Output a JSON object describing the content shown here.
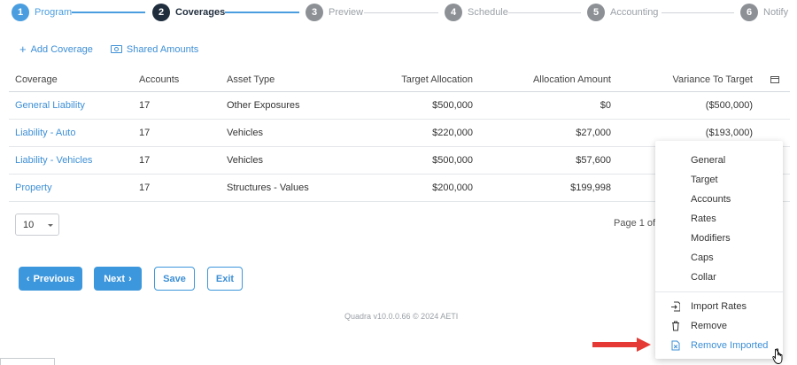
{
  "stepper": {
    "steps": [
      {
        "num": "1",
        "label": "Program"
      },
      {
        "num": "2",
        "label": "Coverages"
      },
      {
        "num": "3",
        "label": "Preview"
      },
      {
        "num": "4",
        "label": "Schedule"
      },
      {
        "num": "5",
        "label": "Accounting"
      },
      {
        "num": "6",
        "label": "Notify"
      }
    ]
  },
  "toolbar": {
    "add_coverage": "Add Coverage",
    "shared_amounts": "Shared Amounts"
  },
  "table": {
    "headers": {
      "coverage": "Coverage",
      "accounts": "Accounts",
      "asset_type": "Asset Type",
      "target_allocation": "Target Allocation",
      "allocation_amount": "Allocation Amount",
      "variance_to_target": "Variance To Target"
    },
    "rows": [
      {
        "coverage": "General Liability",
        "accounts": "17",
        "asset_type": "Other Exposures",
        "target_allocation": "$500,000",
        "allocation_amount": "$0",
        "variance_to_target": "($500,000)"
      },
      {
        "coverage": "Liability - Auto",
        "accounts": "17",
        "asset_type": "Vehicles",
        "target_allocation": "$220,000",
        "allocation_amount": "$27,000",
        "variance_to_target": "($193,000)"
      },
      {
        "coverage": "Liability - Vehicles",
        "accounts": "17",
        "asset_type": "Vehicles",
        "target_allocation": "$500,000",
        "allocation_amount": "$57,600",
        "variance_to_target": ""
      },
      {
        "coverage": "Property",
        "accounts": "17",
        "asset_type": "Structures - Values",
        "target_allocation": "$200,000",
        "allocation_amount": "$199,998",
        "variance_to_target": ""
      }
    ]
  },
  "pagination": {
    "page_size": "10",
    "page_info": "Page 1 of 1"
  },
  "buttons": {
    "previous": "Previous",
    "next": "Next",
    "save": "Save",
    "exit": "Exit"
  },
  "footer": "Quadra v10.0.0.66 © 2024 AETI",
  "context_menu": {
    "items": [
      "General",
      "Target",
      "Accounts",
      "Rates",
      "Modifiers",
      "Caps",
      "Collar"
    ],
    "actions": [
      "Import Rates",
      "Remove",
      "Remove Imported"
    ]
  },
  "colors": {
    "accent": "#3d97dc",
    "active_step": "#1f2d3d",
    "arrow": "#e53935"
  }
}
